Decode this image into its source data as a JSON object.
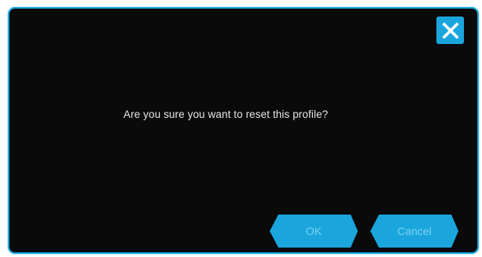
{
  "dialog": {
    "message": "Are you sure you want to reset this profile?",
    "ok_label": "OK",
    "cancel_label": "Cancel"
  },
  "colors": {
    "accent": "#1aa6dd",
    "background": "#0a0a0a",
    "button_text": "#7fd0ef",
    "message_text": "#e6e6e6"
  },
  "icons": {
    "close": "close-icon"
  }
}
